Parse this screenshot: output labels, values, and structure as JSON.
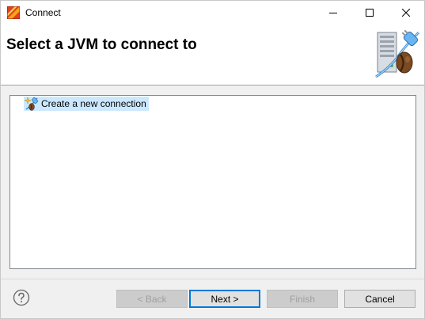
{
  "window": {
    "title": "Connect",
    "controls": {
      "minimize_icon": "minimize-icon",
      "maximize_icon": "maximize-icon",
      "close_icon": "close-icon"
    }
  },
  "header": {
    "title": "Select a JVM to connect to",
    "image": "jvm-connection-banner-icon"
  },
  "tree": {
    "items": [
      {
        "label": "Create a new connection",
        "icon": "new-connection-icon",
        "selected": true
      }
    ]
  },
  "footer": {
    "help_icon": "help-icon",
    "buttons": {
      "back": {
        "label": "< Back",
        "enabled": false
      },
      "next": {
        "label": "Next >",
        "enabled": true,
        "default": true
      },
      "finish": {
        "label": "Finish",
        "enabled": false
      },
      "cancel": {
        "label": "Cancel",
        "enabled": true
      }
    }
  },
  "colors": {
    "selection": "#cce8ff",
    "default_button_border": "#0078d7",
    "dialog_background": "#f0f0f0"
  }
}
